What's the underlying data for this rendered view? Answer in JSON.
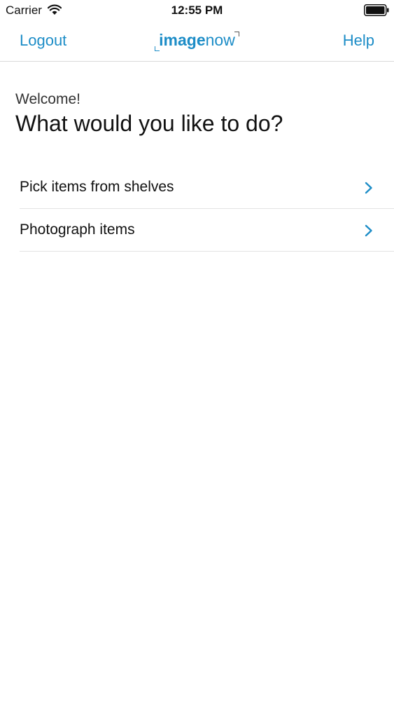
{
  "status_bar": {
    "carrier": "Carrier",
    "time": "12:55 PM",
    "icons": [
      "wifi-icon",
      "battery-icon"
    ]
  },
  "nav": {
    "left_label": "Logout",
    "right_label": "Help",
    "logo": {
      "part1": "image",
      "part2": "now"
    },
    "accent_color": "#1d8dc7"
  },
  "main": {
    "greeting": "Welcome!",
    "title": "What would you like to do?",
    "items": [
      {
        "label": "Pick items from shelves",
        "icon": "chevron-right-icon"
      },
      {
        "label": "Photograph items",
        "icon": "chevron-right-icon"
      }
    ]
  }
}
